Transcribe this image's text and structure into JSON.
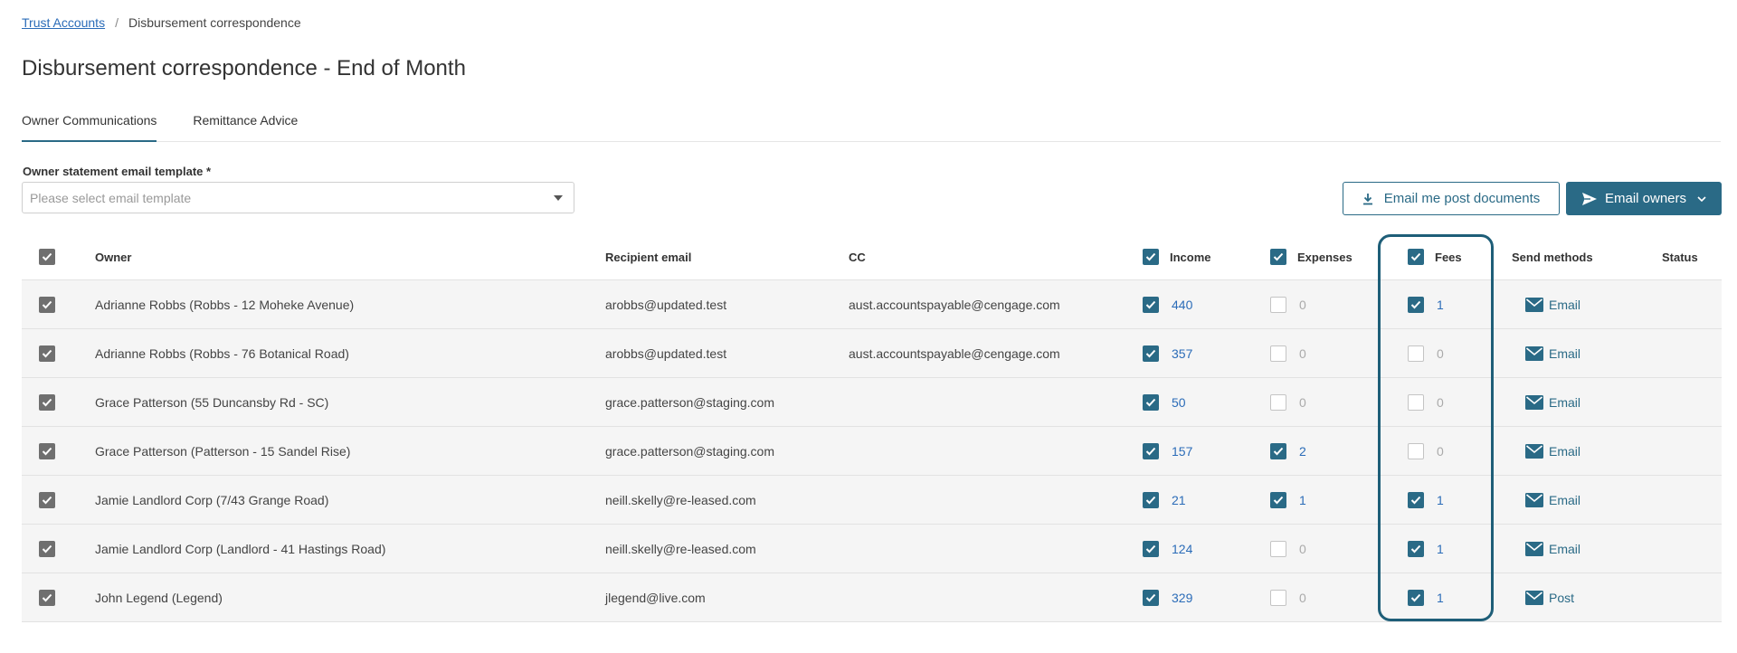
{
  "breadcrumb": {
    "parent": "Trust Accounts",
    "separator": "/",
    "current": "Disbursement correspondence"
  },
  "page_title": "Disbursement correspondence - End of Month",
  "tabs": [
    {
      "label": "Owner Communications",
      "active": true
    },
    {
      "label": "Remittance Advice",
      "active": false
    }
  ],
  "template": {
    "label": "Owner statement email template *",
    "placeholder": "Please select email template"
  },
  "actions": {
    "email_me": "Email me post documents",
    "email_owners": "Email owners"
  },
  "columns": {
    "owner": "Owner",
    "recipient": "Recipient email",
    "cc": "CC",
    "income": "Income",
    "expenses": "Expenses",
    "fees": "Fees",
    "send_methods": "Send methods",
    "status": "Status"
  },
  "rows": [
    {
      "owner": "Adrianne Robbs (Robbs - 12 Moheke Avenue)",
      "recipient": "arobbs@updated.test",
      "cc": "aust.accountspayable@cengage.com",
      "income": {
        "checked": true,
        "count": "440"
      },
      "expenses": {
        "checked": false,
        "count": "0"
      },
      "fees": {
        "checked": true,
        "count": "1"
      },
      "send": "Email",
      "status": ""
    },
    {
      "owner": "Adrianne Robbs (Robbs - 76 Botanical Road)",
      "recipient": "arobbs@updated.test",
      "cc": "aust.accountspayable@cengage.com",
      "income": {
        "checked": true,
        "count": "357"
      },
      "expenses": {
        "checked": false,
        "count": "0"
      },
      "fees": {
        "checked": false,
        "count": "0"
      },
      "send": "Email",
      "status": ""
    },
    {
      "owner": "Grace Patterson (55 Duncansby Rd - SC)",
      "recipient": "grace.patterson@staging.com",
      "cc": "",
      "income": {
        "checked": true,
        "count": "50"
      },
      "expenses": {
        "checked": false,
        "count": "0"
      },
      "fees": {
        "checked": false,
        "count": "0"
      },
      "send": "Email",
      "status": ""
    },
    {
      "owner": "Grace Patterson (Patterson - 15 Sandel Rise)",
      "recipient": "grace.patterson@staging.com",
      "cc": "",
      "income": {
        "checked": true,
        "count": "157"
      },
      "expenses": {
        "checked": true,
        "count": "2"
      },
      "fees": {
        "checked": false,
        "count": "0"
      },
      "send": "Email",
      "status": ""
    },
    {
      "owner": "Jamie Landlord Corp (7/43 Grange Road)",
      "recipient": "neill.skelly@re-leased.com",
      "cc": "",
      "income": {
        "checked": true,
        "count": "21"
      },
      "expenses": {
        "checked": true,
        "count": "1"
      },
      "fees": {
        "checked": true,
        "count": "1"
      },
      "send": "Email",
      "status": ""
    },
    {
      "owner": "Jamie Landlord Corp (Landlord - 41 Hastings Road)",
      "recipient": "neill.skelly@re-leased.com",
      "cc": "",
      "income": {
        "checked": true,
        "count": "124"
      },
      "expenses": {
        "checked": false,
        "count": "0"
      },
      "fees": {
        "checked": true,
        "count": "1"
      },
      "send": "Email",
      "status": ""
    },
    {
      "owner": "John Legend (Legend)",
      "recipient": "jlegend@live.com",
      "cc": "",
      "income": {
        "checked": true,
        "count": "329"
      },
      "expenses": {
        "checked": false,
        "count": "0"
      },
      "fees": {
        "checked": true,
        "count": "1"
      },
      "send": "Post",
      "status": ""
    }
  ],
  "colors": {
    "accent": "#2a6a86",
    "link": "#2b6cb8",
    "row_bg": "#f5f5f5",
    "checkbox_grey": "#6f6f6f"
  },
  "icons": {
    "download": "download-icon",
    "send": "send-arrow-icon",
    "chevron": "chevron-down-icon",
    "envelope": "envelope-icon",
    "check": "check-icon"
  }
}
